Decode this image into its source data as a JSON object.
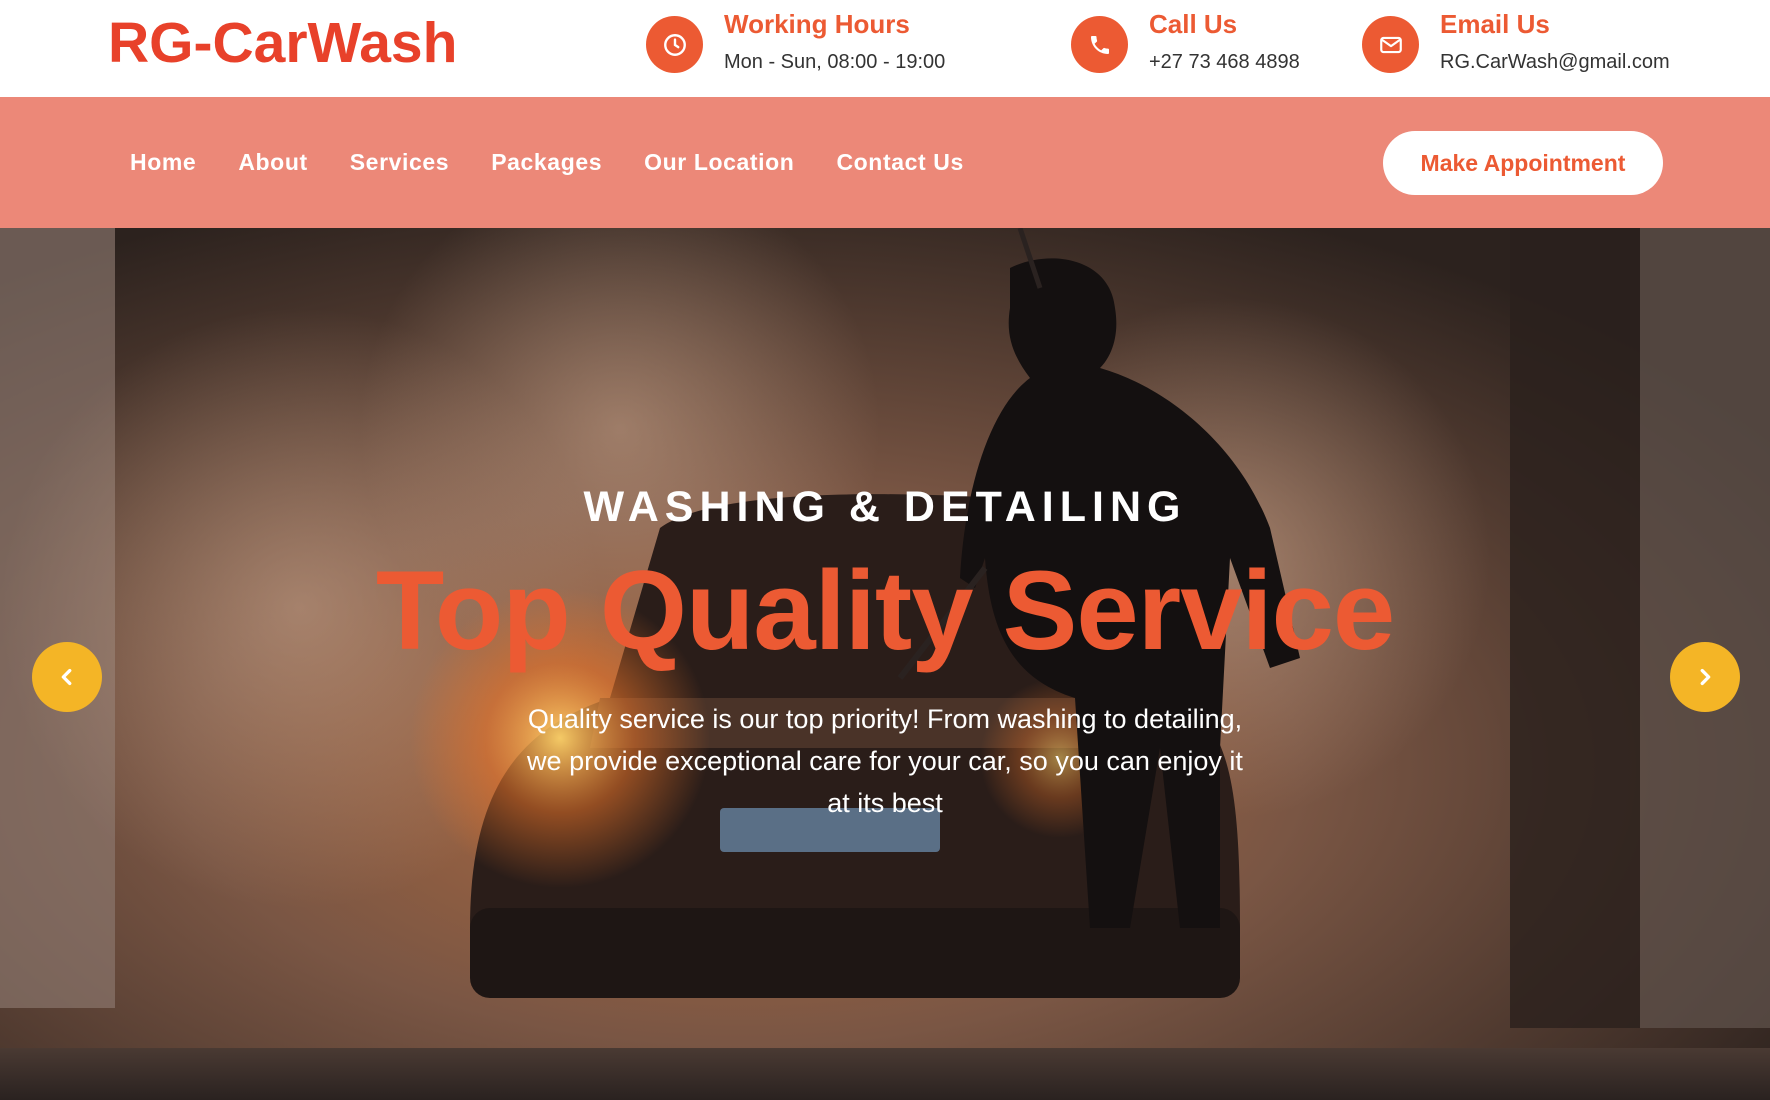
{
  "brand": {
    "name": "RG-CarWash"
  },
  "header": {
    "hours": {
      "title": "Working Hours",
      "value": "Mon - Sun, 08:00 - 19:00",
      "icon": "clock-icon"
    },
    "call": {
      "title": "Call Us",
      "value": "+27 73 468 4898",
      "icon": "phone-icon"
    },
    "email": {
      "title": "Email Us",
      "value": "RG.CarWash@gmail.com",
      "icon": "envelope-icon"
    }
  },
  "nav": {
    "items": [
      {
        "label": "Home"
      },
      {
        "label": "About"
      },
      {
        "label": "Services"
      },
      {
        "label": "Packages"
      },
      {
        "label": "Our Location"
      },
      {
        "label": "Contact Us"
      }
    ],
    "cta_label": "Make Appointment"
  },
  "hero": {
    "kicker": "WASHING & DETAILING",
    "headline": "Top Quality Service",
    "description": "Quality service is our top priority! From washing to detailing, we provide exceptional care for your car, so you can enjoy it at its best",
    "prev_icon": "chevron-left-icon",
    "next_icon": "chevron-right-icon"
  },
  "colors": {
    "brand": "#e8412a",
    "accent": "#ec5a33",
    "nav_bg": "#ec8878",
    "arrow_bg": "#f4b526"
  }
}
